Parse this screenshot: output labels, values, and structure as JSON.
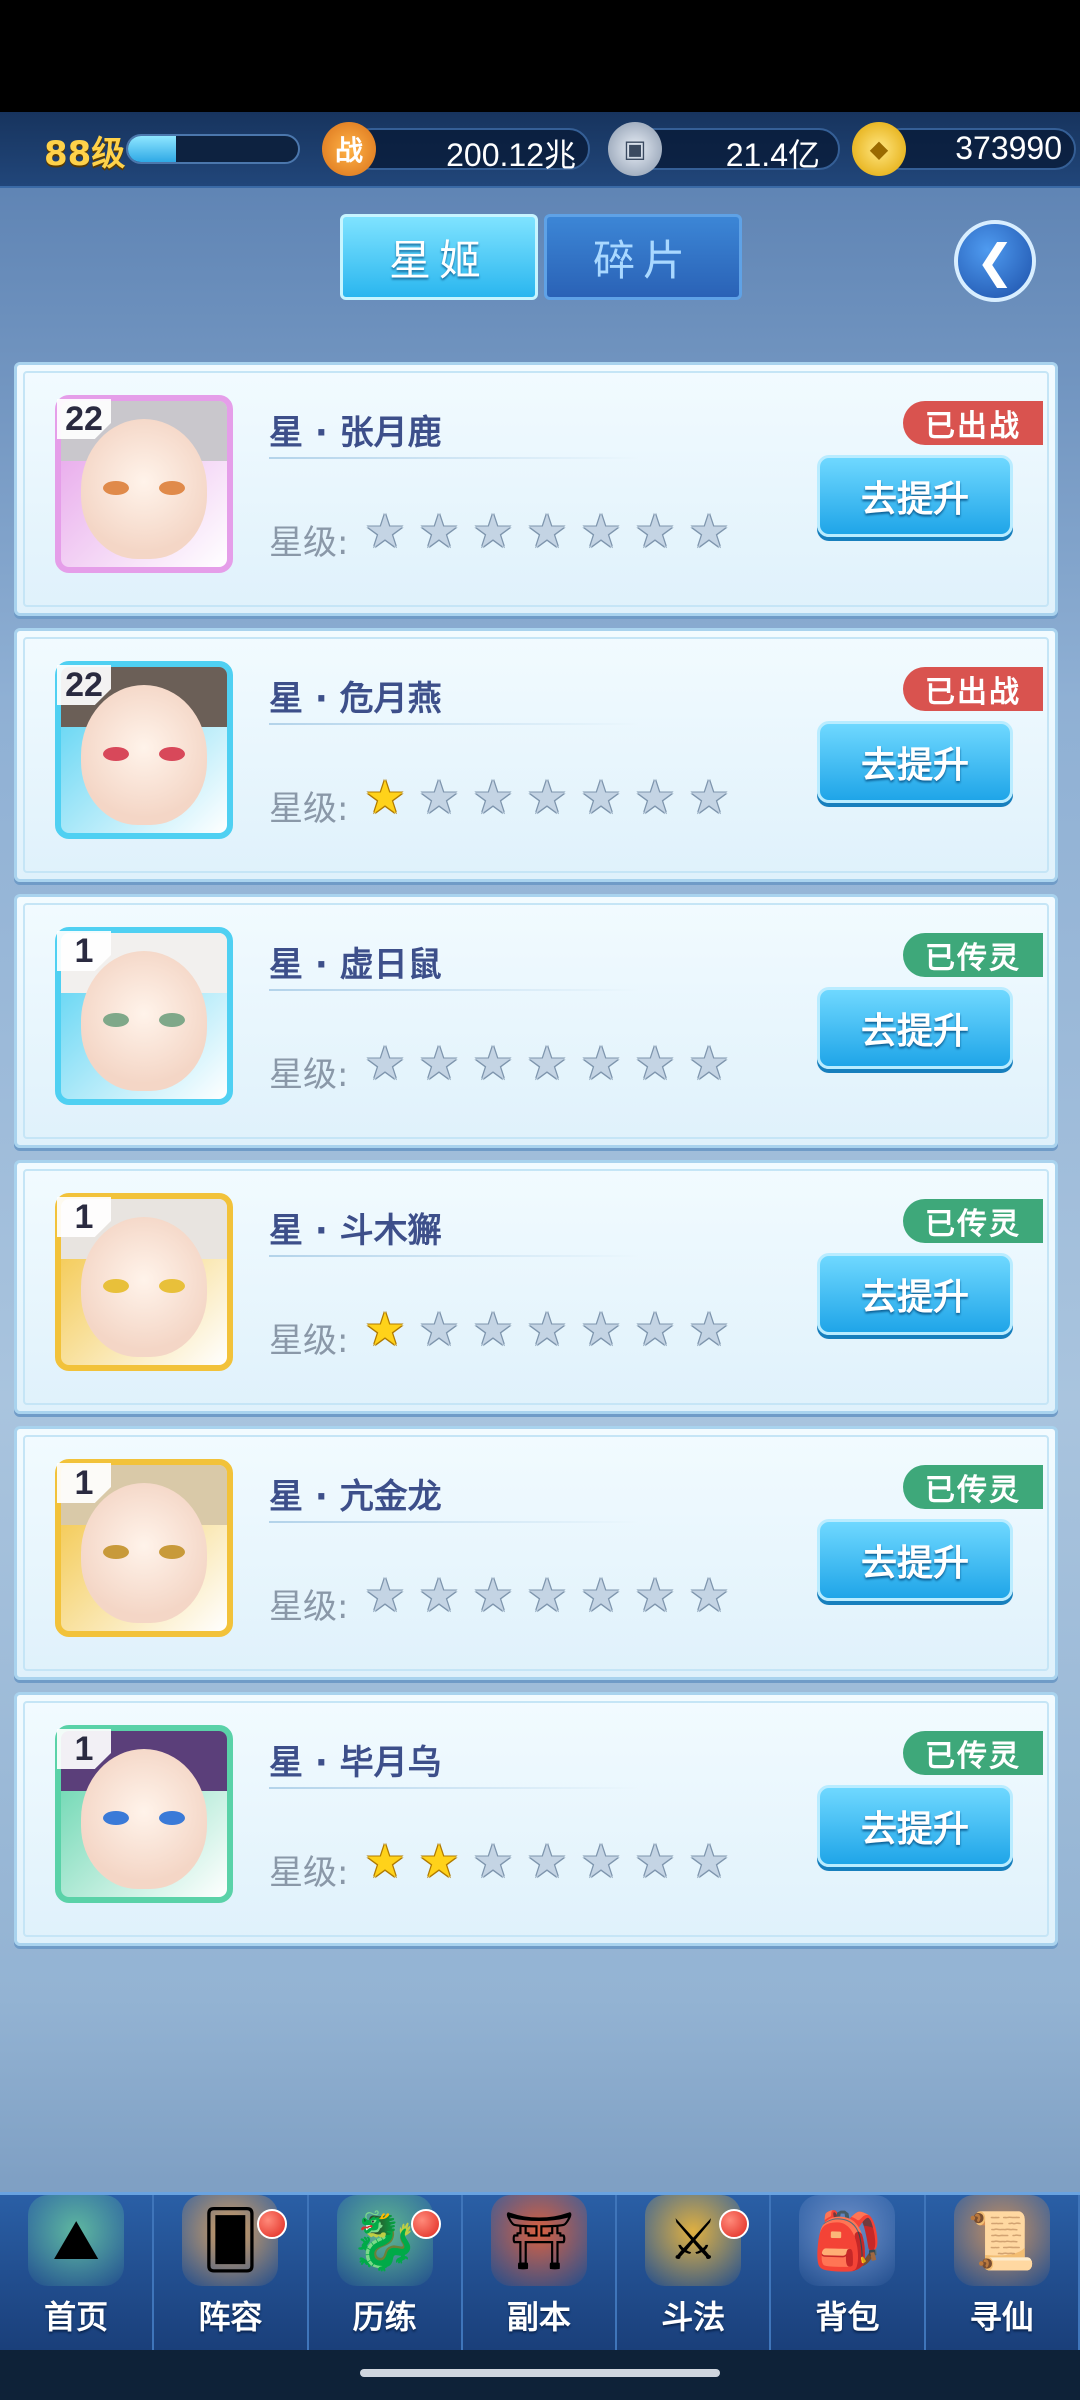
{
  "top_bar": {
    "level": "88级",
    "xp_fraction": 0.28,
    "power_value": "200.12兆",
    "coin_value": "21.4亿",
    "gold_value": "373990"
  },
  "tabs": [
    {
      "label": "星姬",
      "active": true
    },
    {
      "label": "碎片",
      "active": false
    }
  ],
  "heroes": [
    {
      "level": "22",
      "name": "星 · 张月鹿",
      "star_label": "星级:",
      "stars_filled": 0,
      "stars_total": 7,
      "status": "已出战",
      "status_color": "#d9534f",
      "frame_color": "#e59ee9",
      "action": "去提升"
    },
    {
      "level": "22",
      "name": "星 · 危月燕",
      "star_label": "星级:",
      "stars_filled": 1,
      "stars_total": 7,
      "status": "已出战",
      "status_color": "#d9534f",
      "frame_color": "#4fd0f2",
      "action": "去提升"
    },
    {
      "level": "1",
      "name": "星 · 虚日鼠",
      "star_label": "星级:",
      "stars_filled": 0,
      "stars_total": 7,
      "status": "已传灵",
      "status_color": "#3ea87a",
      "frame_color": "#4fd0f2",
      "action": "去提升"
    },
    {
      "level": "1",
      "name": "星 · 斗木獬",
      "star_label": "星级:",
      "stars_filled": 1,
      "stars_total": 7,
      "status": "已传灵",
      "status_color": "#3ea87a",
      "frame_color": "#f2c23a",
      "action": "去提升"
    },
    {
      "level": "1",
      "name": "星 · 亢金龙",
      "star_label": "星级:",
      "stars_filled": 0,
      "stars_total": 7,
      "status": "已传灵",
      "status_color": "#3ea87a",
      "frame_color": "#f2c23a",
      "action": "去提升"
    },
    {
      "level": "1",
      "name": "星 · 毕月乌",
      "star_label": "星级:",
      "stars_filled": 2,
      "stars_total": 7,
      "status": "已传灵",
      "status_color": "#3ea87a",
      "frame_color": "#5ad2a8",
      "action": "去提升"
    }
  ],
  "bottom_nav": [
    {
      "label": "首页",
      "icon": "home-island-icon",
      "badge": false
    },
    {
      "label": "阵容",
      "icon": "lineup-cards-icon",
      "badge": true
    },
    {
      "label": "历练",
      "icon": "training-dragon-icon",
      "badge": true
    },
    {
      "label": "副本",
      "icon": "dungeon-gate-icon",
      "badge": false
    },
    {
      "label": "斗法",
      "icon": "battle-sword-icon",
      "badge": true
    },
    {
      "label": "背包",
      "icon": "backpack-icon",
      "badge": false
    },
    {
      "label": "寻仙",
      "icon": "scroll-icon",
      "badge": false
    }
  ]
}
